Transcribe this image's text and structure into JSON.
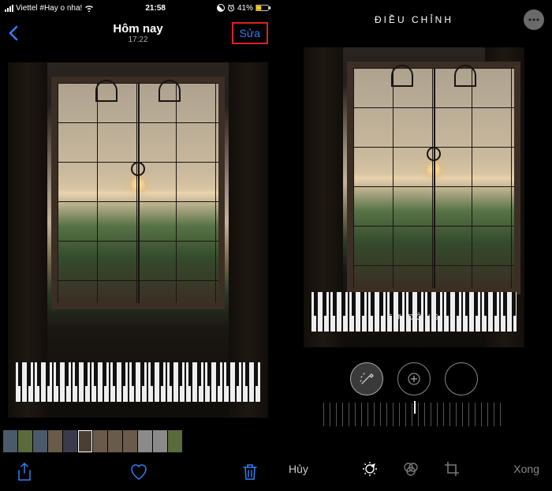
{
  "left": {
    "statusbar": {
      "carrier": "Viettel #Hay o nha!",
      "time": "21:58",
      "battery_text": "41%",
      "icons": [
        "wifi-icon",
        "alarm-icon",
        "battery-icon"
      ]
    },
    "nav": {
      "title": "Hôm nay",
      "subtitle": "17:22",
      "edit_label": "Sửa"
    },
    "toolbar": {
      "share_label": "Share",
      "like_label": "Like",
      "delete_label": "Delete"
    }
  },
  "right": {
    "header": {
      "title": "ĐIỀU CHỈNH"
    },
    "auto_label": "TỰ ĐỘNG",
    "footer": {
      "cancel": "Hủy",
      "done": "Xong"
    }
  }
}
